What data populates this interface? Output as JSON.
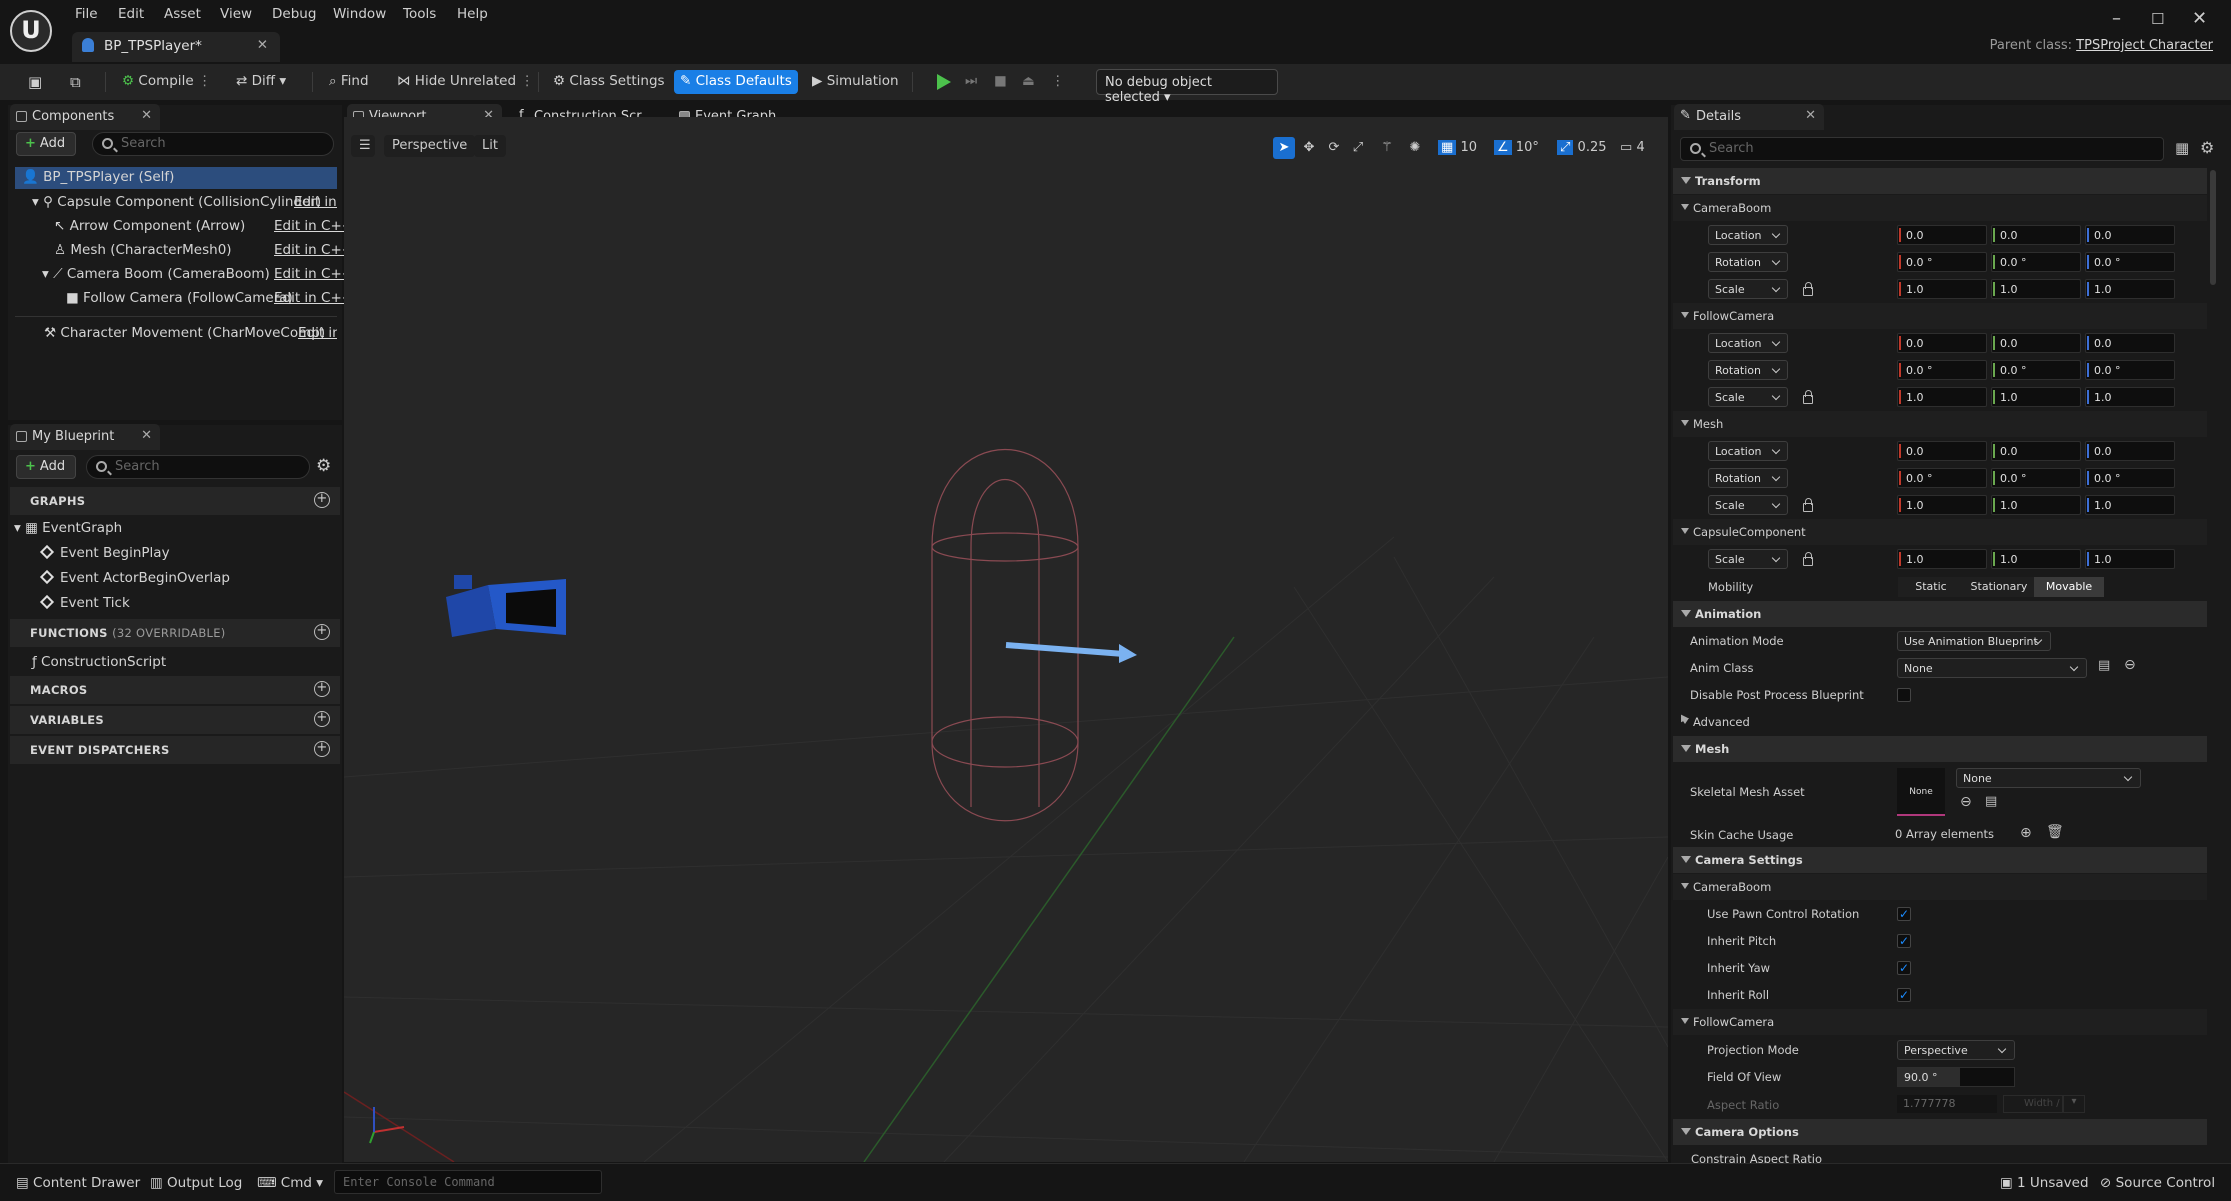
{
  "menu": [
    "File",
    "Edit",
    "Asset",
    "View",
    "Debug",
    "Window",
    "Tools",
    "Help"
  ],
  "doc_tab": "BP_TPSPlayer*",
  "parent_class_label": "Parent class:",
  "parent_class_value": "TPSProject Character",
  "toolbar": {
    "compile": "Compile",
    "diff": "Diff",
    "find": "Find",
    "hide_unrelated": "Hide Unrelated",
    "class_settings": "Class Settings",
    "class_defaults": "Class Defaults",
    "simulation": "Simulation",
    "debug_object": "No debug object selected"
  },
  "components": {
    "tab": "Components",
    "add": "Add",
    "search_placeholder": "Search",
    "items": [
      {
        "label": "BP_TPSPlayer (Self)"
      },
      {
        "label": "Capsule Component (CollisionCylinder)",
        "edit": "Edit in C"
      },
      {
        "label": "Arrow Component (Arrow)",
        "edit": "Edit in C++"
      },
      {
        "label": "Mesh (CharacterMesh0)",
        "edit": "Edit in C++"
      },
      {
        "label": "Camera Boom (CameraBoom)",
        "edit": "Edit in C++"
      },
      {
        "label": "Follow Camera (FollowCamera)",
        "edit": "Edit in C++"
      },
      {
        "label": "Character Movement (CharMoveComp)",
        "edit": "Edit in"
      }
    ]
  },
  "my_blueprint": {
    "tab": "My Blueprint",
    "add": "Add",
    "search_placeholder": "Search",
    "graphs": "GRAPHS",
    "event_graph": "EventGraph",
    "events": [
      "Event BeginPlay",
      "Event ActorBeginOverlap",
      "Event Tick"
    ],
    "functions": "FUNCTIONS",
    "functions_sub": "(32 OVERRIDABLE)",
    "construction_script": "ConstructionScript",
    "macros": "MACROS",
    "variables": "VARIABLES",
    "dispatchers": "EVENT DISPATCHERS"
  },
  "editor_tabs": [
    "Viewport",
    "Construction Scr...",
    "Event Graph"
  ],
  "viewport": {
    "perspective": "Perspective",
    "lit": "Lit",
    "grid": "10",
    "angle": "10°",
    "scale": "0.25",
    "camera_speed": "4"
  },
  "details": {
    "tab": "Details",
    "search_placeholder": "Search",
    "transform": "Transform",
    "groups": [
      {
        "name": "CameraBoom",
        "rows": [
          {
            "label": "Location",
            "v": [
              "0.0",
              "0.0",
              "0.0"
            ]
          },
          {
            "label": "Rotation",
            "v": [
              "0.0 °",
              "0.0 °",
              "0.0 °"
            ]
          },
          {
            "label": "Scale",
            "v": [
              "1.0",
              "1.0",
              "1.0"
            ]
          }
        ]
      },
      {
        "name": "FollowCamera",
        "rows": [
          {
            "label": "Location",
            "v": [
              "0.0",
              "0.0",
              "0.0"
            ]
          },
          {
            "label": "Rotation",
            "v": [
              "0.0 °",
              "0.0 °",
              "0.0 °"
            ]
          },
          {
            "label": "Scale",
            "v": [
              "1.0",
              "1.0",
              "1.0"
            ]
          }
        ]
      },
      {
        "name": "Mesh",
        "rows": [
          {
            "label": "Location",
            "v": [
              "0.0",
              "0.0",
              "0.0"
            ]
          },
          {
            "label": "Rotation",
            "v": [
              "0.0 °",
              "0.0 °",
              "0.0 °"
            ]
          },
          {
            "label": "Scale",
            "v": [
              "1.0",
              "1.0",
              "1.0"
            ]
          }
        ]
      },
      {
        "name": "CapsuleComponent",
        "rows": [
          {
            "label": "Scale",
            "v": [
              "1.0",
              "1.0",
              "1.0"
            ]
          }
        ]
      }
    ],
    "mobility_label": "Mobility",
    "mobility_options": [
      "Static",
      "Stationary",
      "Movable"
    ],
    "mobility_selected": "Movable",
    "animation": "Animation",
    "animation_mode_label": "Animation Mode",
    "animation_mode_value": "Use Animation Blueprint",
    "anim_class_label": "Anim Class",
    "anim_class_value": "None",
    "disable_pp_label": "Disable Post Process Blueprint",
    "advanced": "Advanced",
    "mesh": "Mesh",
    "skeletal_mesh_label": "Skeletal Mesh Asset",
    "skeletal_mesh_thumb": "None",
    "skeletal_mesh_value": "None",
    "skin_cache_label": "Skin Cache Usage",
    "skin_cache_value": "0 Array elements",
    "camera_settings": "Camera Settings",
    "camera_boom": "CameraBoom",
    "pawn_rotation": "Use Pawn Control Rotation",
    "inherit_pitch": "Inherit Pitch",
    "inherit_yaw": "Inherit Yaw",
    "inherit_roll": "Inherit Roll",
    "follow_camera": "FollowCamera",
    "projection_label": "Projection Mode",
    "projection_value": "Perspective",
    "fov_label": "Field Of View",
    "fov_value": "90.0 °",
    "aspect_label": "Aspect Ratio",
    "aspect_value": "1.777778",
    "aspect_width": "Width /",
    "camera_options": "Camera Options",
    "constrain_label": "Constrain Aspect Ratio"
  },
  "status": {
    "content_drawer": "Content Drawer",
    "output_log": "Output Log",
    "cmd": "Cmd",
    "console_placeholder": "Enter Console Command",
    "unsaved": "1 Unsaved",
    "source_control": "Source Control"
  }
}
